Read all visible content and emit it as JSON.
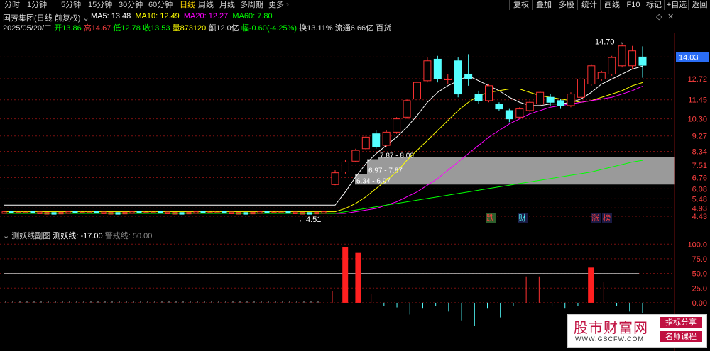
{
  "toolbar": {
    "periods": [
      "分时",
      "1分钟",
      "5分钟",
      "15分钟",
      "30分钟",
      "60分钟",
      "日线",
      "周线",
      "月线",
      "多周期",
      "更多"
    ],
    "active_period": "日线",
    "buttons": [
      "复权",
      "叠加",
      "多股",
      "统计",
      "画线",
      "F10",
      "标记",
      "+自选",
      "返回"
    ]
  },
  "header": {
    "stock": "国芳集团(日线 前复权)",
    "ma5": "MA5: 13.48",
    "ma10": "MA10: 12.49",
    "ma20": "MA20: 12.27",
    "ma60": "MA60: 7.80",
    "date": "2025/05/20/二",
    "open_label": "开",
    "open": "13.86",
    "high_label": "高",
    "high": "14.67",
    "low_label": "低",
    "low": "12.78",
    "close_label": "收",
    "close": "13.53",
    "vol_label": "量",
    "vol": "873120",
    "amount_label": "额",
    "amount": "12.0亿",
    "chg_label": "幅",
    "chg": "-0.60(-4.25%)",
    "turnover_label": "换",
    "turnover": "13.11%",
    "float_label": "流通",
    "float": "6.66亿",
    "industry": "百货"
  },
  "colors": {
    "up": "#ff3232",
    "down": "#54ffff",
    "ma5": "#ffffff",
    "ma10": "#ffff00",
    "ma20": "#ff00ff",
    "ma60": "#00ff00",
    "bg": "#000000"
  },
  "chart_data": [
    {
      "type": "candlestick",
      "title": "国芳集团(日线 前复权)",
      "y_ticks": [
        "14.03",
        "12.72",
        "11.45",
        "10.30",
        "9.27",
        "8.34",
        "7.51",
        "6.76",
        "6.08",
        "5.48",
        "4.93",
        "4.43"
      ],
      "ylim": [
        4.3,
        15.5
      ],
      "current_price": "14.03",
      "annotations": {
        "high": "14.70",
        "low": "4.51",
        "zones": [
          "7.87 - 8.00",
          "6.97 - 7.87",
          "6.34 - 6.97"
        ],
        "markers": [
          "跌",
          "财",
          "涨",
          "榜"
        ]
      },
      "candles": [
        {
          "o": 6.34,
          "c": 7.05,
          "h": 7.2,
          "l": 6.3
        },
        {
          "o": 7.1,
          "c": 7.7,
          "h": 7.85,
          "l": 7.0
        },
        {
          "o": 7.75,
          "c": 8.4,
          "h": 8.5,
          "l": 7.7
        },
        {
          "o": 8.5,
          "c": 9.2,
          "h": 9.3,
          "l": 8.4
        },
        {
          "o": 9.4,
          "c": 8.6,
          "h": 9.6,
          "l": 8.5
        },
        {
          "o": 8.7,
          "c": 9.5,
          "h": 9.6,
          "l": 8.6
        },
        {
          "o": 9.5,
          "c": 10.3,
          "h": 10.4,
          "l": 9.4
        },
        {
          "o": 10.4,
          "c": 11.4,
          "h": 11.5,
          "l": 10.3
        },
        {
          "o": 11.5,
          "c": 12.5,
          "h": 12.6,
          "l": 11.4
        },
        {
          "o": 12.6,
          "c": 13.8,
          "h": 14.0,
          "l": 12.5
        },
        {
          "o": 13.9,
          "c": 12.7,
          "h": 14.1,
          "l": 12.5
        },
        {
          "o": 12.7,
          "c": 12.7,
          "h": 13.0,
          "l": 12.4
        },
        {
          "o": 13.8,
          "c": 11.8,
          "h": 14.0,
          "l": 11.6
        },
        {
          "o": 13.0,
          "c": 12.7,
          "h": 14.2,
          "l": 12.3
        },
        {
          "o": 11.8,
          "c": 11.4,
          "h": 12.0,
          "l": 11.2
        },
        {
          "o": 11.4,
          "c": 12.3,
          "h": 12.4,
          "l": 11.3
        },
        {
          "o": 11.2,
          "c": 10.9,
          "h": 11.3,
          "l": 10.8
        },
        {
          "o": 10.8,
          "c": 10.3,
          "h": 10.9,
          "l": 10.1
        },
        {
          "o": 10.4,
          "c": 10.9,
          "h": 11.0,
          "l": 10.3
        },
        {
          "o": 10.8,
          "c": 11.3,
          "h": 11.4,
          "l": 10.7
        },
        {
          "o": 11.2,
          "c": 11.9,
          "h": 12.0,
          "l": 11.1
        },
        {
          "o": 11.6,
          "c": 11.3,
          "h": 11.8,
          "l": 11.1
        },
        {
          "o": 11.4,
          "c": 11.1,
          "h": 11.5,
          "l": 10.9
        },
        {
          "o": 11.1,
          "c": 11.8,
          "h": 11.9,
          "l": 11.0
        },
        {
          "o": 11.6,
          "c": 12.7,
          "h": 12.8,
          "l": 11.5
        },
        {
          "o": 12.4,
          "c": 13.5,
          "h": 13.6,
          "l": 12.3
        },
        {
          "o": 12.7,
          "c": 13.1,
          "h": 13.2,
          "l": 12.6
        },
        {
          "o": 13.0,
          "c": 14.0,
          "h": 14.1,
          "l": 12.9
        },
        {
          "o": 13.5,
          "c": 14.7,
          "h": 14.8,
          "l": 13.4
        },
        {
          "o": 13.5,
          "c": 14.4,
          "h": 14.7,
          "l": 13.3
        },
        {
          "o": 14.03,
          "c": 13.53,
          "h": 14.67,
          "l": 12.78
        }
      ],
      "series": [
        {
          "name": "MA5",
          "values": [
            5.1,
            5.9,
            6.8,
            7.6,
            8.2,
            8.7,
            9.2,
            9.8,
            10.5,
            11.3,
            11.9,
            12.3,
            12.6,
            12.9,
            12.6,
            12.3,
            12.0,
            11.6,
            11.3,
            11.1,
            11.1,
            11.2,
            11.2,
            11.3,
            11.5,
            11.9,
            12.4,
            12.7,
            13.0,
            13.3,
            13.48
          ]
        },
        {
          "name": "MA10",
          "values": [
            4.7,
            4.9,
            5.2,
            5.6,
            6.1,
            6.6,
            7.1,
            7.8,
            8.4,
            9.0,
            9.6,
            10.2,
            10.8,
            11.3,
            11.7,
            11.9,
            12.0,
            12.1,
            12.1,
            11.9,
            11.7,
            11.6,
            11.5,
            11.4,
            11.3,
            11.4,
            11.6,
            11.8,
            12.0,
            12.3,
            12.49
          ]
        },
        {
          "name": "MA20",
          "values": [
            4.6,
            4.6,
            4.7,
            4.8,
            4.9,
            5.1,
            5.3,
            5.6,
            5.9,
            6.3,
            6.7,
            7.2,
            7.7,
            8.2,
            8.7,
            9.2,
            9.6,
            10.0,
            10.3,
            10.6,
            10.8,
            11.0,
            11.1,
            11.2,
            11.3,
            11.4,
            11.5,
            11.6,
            11.8,
            12.0,
            12.27
          ]
        },
        {
          "name": "MA60",
          "values": [
            4.6,
            4.7,
            4.8,
            4.9,
            5.0,
            5.1,
            5.2,
            5.3,
            5.4,
            5.5,
            5.6,
            5.7,
            5.8,
            5.9,
            6.0,
            6.1,
            6.2,
            6.3,
            6.4,
            6.5,
            6.6,
            6.7,
            6.8,
            6.9,
            7.0,
            7.1,
            7.25,
            7.4,
            7.55,
            7.7,
            7.8
          ]
        }
      ]
    },
    {
      "type": "bar",
      "title": "测妖线副图",
      "indicator": "测妖线: -17.00",
      "warning": "警戒线: 50.00",
      "y_ticks": [
        "100.0",
        "75.0",
        "50.0",
        "25.0",
        "0.00"
      ],
      "ylim": [
        -40,
        110
      ],
      "warning_level": 50,
      "values": [
        20,
        95,
        85,
        15,
        -5,
        -8,
        -20,
        -10,
        -5,
        -15,
        -30,
        -40,
        -10,
        -25,
        -5,
        45,
        45,
        -5,
        -10,
        -5,
        60,
        35,
        -5,
        -15,
        -17
      ]
    }
  ],
  "watermark": {
    "title": "股市财富网",
    "url": "WWW.GSCFW.COM",
    "tag1": "指标分享",
    "tag2": "名师课程"
  }
}
